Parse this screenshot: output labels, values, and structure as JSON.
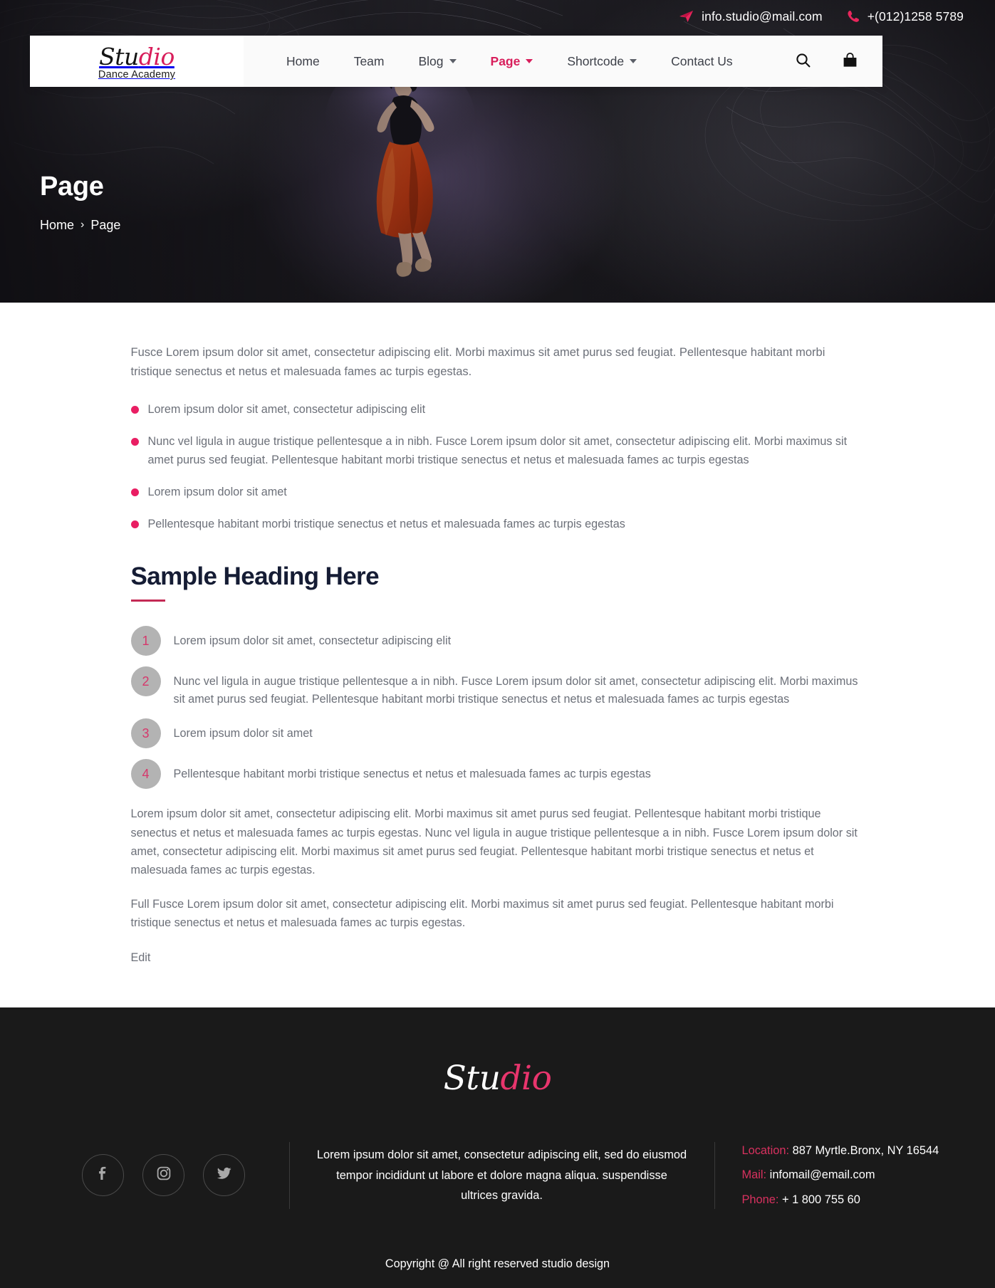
{
  "topbar": {
    "email": "info.studio@mail.com",
    "phone": "+(012)1258 5789",
    "email_icon": "send-icon",
    "phone_icon": "phone-icon"
  },
  "header": {
    "logo": {
      "part1": "Stu",
      "part2": "dio",
      "subtitle": "Dance Academy"
    },
    "nav": [
      {
        "label": "Home",
        "has_caret": false,
        "active": false
      },
      {
        "label": "Team",
        "has_caret": false,
        "active": false
      },
      {
        "label": "Blog",
        "has_caret": true,
        "active": false
      },
      {
        "label": "Page",
        "has_caret": true,
        "active": true
      },
      {
        "label": "Shortcode",
        "has_caret": true,
        "active": false
      },
      {
        "label": "Contact Us",
        "has_caret": false,
        "active": false
      }
    ],
    "tools": [
      {
        "name": "search-icon"
      },
      {
        "name": "shopping-bag-icon"
      }
    ]
  },
  "hero": {
    "title": "Page",
    "breadcrumb": {
      "home": "Home",
      "separator": "›",
      "current": "Page"
    }
  },
  "main": {
    "intro": "Fusce Lorem ipsum dolor sit amet, consectetur adipiscing elit. Morbi maximus sit amet purus sed feugiat. Pellentesque habitant morbi tristique senectus et netus et malesuada fames ac turpis egestas.",
    "bullets": [
      "Lorem ipsum dolor sit amet, consectetur adipiscing elit",
      "Nunc vel ligula in augue tristique pellentesque a in nibh. Fusce Lorem ipsum dolor sit amet, consectetur adipiscing elit. Morbi maximus sit amet purus sed feugiat. Pellentesque habitant morbi tristique senectus et netus et malesuada fames ac turpis egestas",
      "Lorem ipsum dolor sit amet",
      "Pellentesque habitant morbi tristique senectus et netus et malesuada fames ac turpis egestas"
    ],
    "heading": "Sample Heading Here",
    "numbered": [
      {
        "num": "1",
        "text": "Lorem ipsum dolor sit amet, consectetur adipiscing elit"
      },
      {
        "num": "2",
        "text": "Nunc vel ligula in augue tristique pellentesque a in nibh. Fusce Lorem ipsum dolor sit amet, consectetur adipiscing elit. Morbi maximus sit amet purus sed feugiat. Pellentesque habitant morbi tristique senectus et netus et malesuada fames ac turpis egestas"
      },
      {
        "num": "3",
        "text": "Lorem ipsum dolor sit amet"
      },
      {
        "num": "4",
        "text": "Pellentesque habitant morbi tristique senectus et netus et malesuada fames ac turpis egestas"
      }
    ],
    "paragraph1": "Lorem ipsum dolor sit amet, consectetur adipiscing elit. Morbi maximus sit amet purus sed feugiat. Pellentesque habitant morbi tristique senectus et netus et malesuada fames ac turpis egestas. Nunc vel ligula in augue tristique pellentesque a in nibh. Fusce Lorem ipsum dolor sit amet, consectetur adipiscing elit. Morbi maximus sit amet purus sed feugiat. Pellentesque habitant morbi tristique senectus et netus et malesuada fames ac turpis egestas.",
    "paragraph2": "Full Fusce Lorem ipsum dolor sit amet, consectetur adipiscing elit. Morbi maximus sit amet purus sed feugiat. Pellentesque habitant morbi tristique senectus et netus et malesuada fames ac turpis egestas.",
    "edit_label": "Edit"
  },
  "footer": {
    "logo": {
      "part1": "Stu",
      "part2": "dio"
    },
    "social": [
      {
        "name": "facebook-icon"
      },
      {
        "name": "instagram-icon"
      },
      {
        "name": "twitter-icon"
      }
    ],
    "about": "Lorem ipsum dolor sit amet, consectetur adipiscing elit, sed do eiusmod tempor incididunt ut labore et dolore magna aliqua. suspendisse ultrices gravida.",
    "contact": {
      "location_label": "Location:",
      "location_value": "887 Myrtle.Bronx, NY 16544",
      "mail_label": "Mail:",
      "mail_value": "infomail@email.com",
      "phone_label": "Phone:",
      "phone_value": "+ 1 800 755 60"
    },
    "copyright": "Copyright @ All right reserved studio design"
  },
  "colors": {
    "accent_pink": "#d81e5b",
    "bullet_pink": "#e91e63",
    "heading_navy": "#151c34",
    "body_gray": "#6c7079",
    "footer_bg": "#1a1a1a"
  }
}
